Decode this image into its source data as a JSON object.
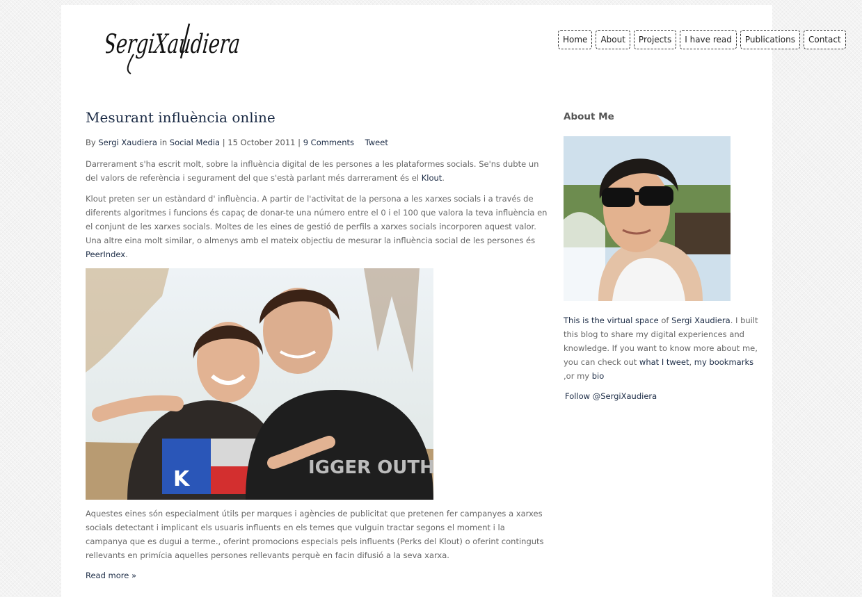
{
  "brand": {
    "logo_text": "SergiXaudiera"
  },
  "nav": {
    "items": [
      {
        "label": "Home"
      },
      {
        "label": "About"
      },
      {
        "label": "Projects"
      },
      {
        "label": "I have read"
      },
      {
        "label": "Publications"
      },
      {
        "label": "Contact"
      }
    ]
  },
  "post": {
    "title": "Mesurant influència online",
    "meta": {
      "by": "By",
      "author": "Sergi Xaudiera",
      "in": "in",
      "category": "Social Media",
      "sep1": "|",
      "date": "15 October 2011",
      "sep2": "|",
      "comments": "9 Comments",
      "tweet": "Tweet"
    },
    "p1": "Darrerament s'ha escrit molt, sobre la influència digital de les persones a les plataformes socials. Se'ns dubte un del valors de referència i segurament del que s'està parlant més darrerament és el ",
    "p1_link": "Klout",
    "p1_end": ".",
    "p2": "Klout preten ser un estàndard d' influència. A partir de l'activitat de la persona a les xarxes socials i a través de diferents algoritmes i funcions és capaç de donar-te una número entre el 0 i el 100 que valora la teva influència en el conjunt de les xarxes socials. Moltes de les eines de gestió de perfils a xarxes socials incorporen aquest valor.  Una altre eina molt similar, o almenys amb el mateix objectiu de mesurar la influència social de les persones és ",
    "p2_link": "PeerIndex",
    "p2_end": ".",
    "p3": "Aquestes eines són especialment útils per marques i agències de publicitat que pretenen fer campanyes a xarxes socials detectant i implicant els usuaris influents en els temes que vulguin tractar segons el moment i la campanya que es dugui a terme., oferint promocions especials pels influents (Perks del Klout) o oferint continguts rellevants en primícia aquelles persones rellevants perquè en facin difusió a la seva xarxa.",
    "read_more": "Read more »",
    "photo_shirt_letter": "K",
    "photo_tshirt_text": "IGGER OUTH"
  },
  "sidebar": {
    "title": "About Me",
    "text1": "This is the virtual space",
    "text_of": " of ",
    "name_link": "Sergi Xaudiera",
    "text2": ". I built this blog to share my digital experiences and knowledge. If you want to know more about me, you can check out ",
    "tweet_link": "what I tweet",
    "comma": ", ",
    "bookmarks_link": "my bookmarks",
    "or": " ,or my ",
    "bio_link": "bio",
    "follow": "Follow @SergiXaudiera"
  },
  "colors": {
    "link": "#1b2b45",
    "body_text": "#666666",
    "background": "#f3f3f3"
  }
}
